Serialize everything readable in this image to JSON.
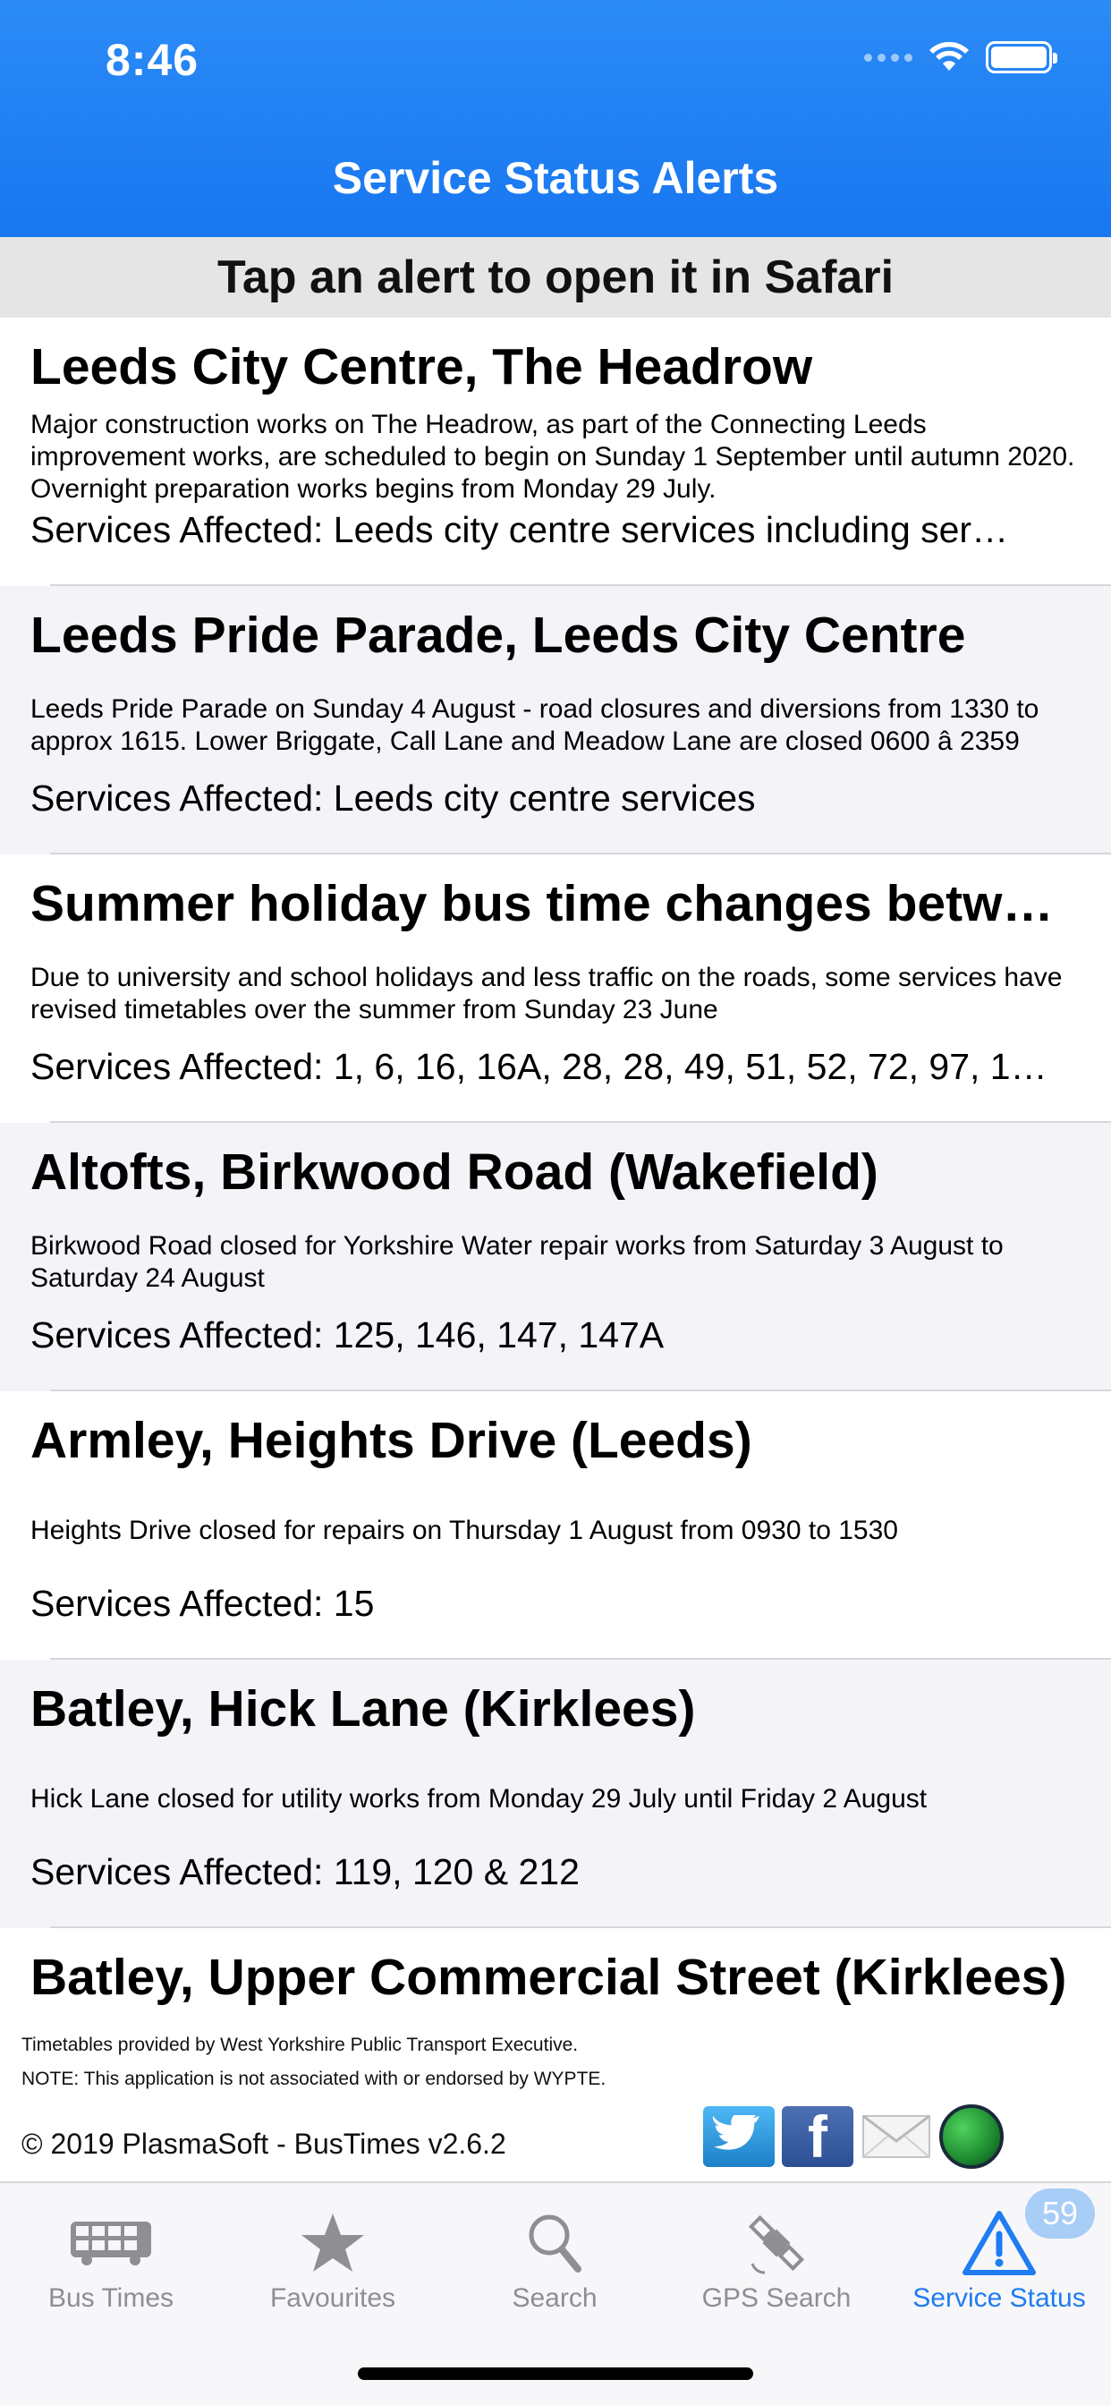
{
  "status_bar": {
    "time": "8:46"
  },
  "nav": {
    "title": "Service Status Alerts"
  },
  "banner": {
    "text": "Tap an alert to open it in Safari"
  },
  "alerts": [
    {
      "title": "Leeds City Centre, The Headrow",
      "description": "Major construction works on The Headrow, as part of the Connecting Leeds improvement works, are scheduled to begin on Sunday 1 September until autumn 2020. Overnight preparation works begins from Monday 29 July.",
      "services": "Services Affected: Leeds city centre services including ser…"
    },
    {
      "title": "Leeds Pride Parade, Leeds City Centre",
      "description": "Leeds Pride Parade on Sunday 4 August - road closures and diversions from 1330 to approx 1615.  Lower Briggate, Call Lane and Meadow Lane are closed 0600 â 2359",
      "services": "Services Affected: Leeds city centre services"
    },
    {
      "title": "Summer holiday bus time changes betwee…",
      "description": "Due to university and school holidays and less traffic on the roads, some services have revised timetables over the summer from Sunday 23 June",
      "services": "Services Affected: 1, 6, 16, 16A, 28, 28, 49, 51, 52, 72, 97, 1…"
    },
    {
      "title": "Altofts, Birkwood Road (Wakefield)",
      "description": "Birkwood Road closed for Yorkshire Water repair works from Saturday 3 August to Saturday 24 August",
      "services": "Services Affected: 125, 146, 147, 147A"
    },
    {
      "title": "Armley, Heights Drive (Leeds)",
      "description": "Heights Drive closed for repairs on Thursday 1 August from 0930 to 1530",
      "services": "Services Affected: 15"
    },
    {
      "title": "Batley, Hick Lane (Kirklees)",
      "description": "Hick Lane closed for utility works from Monday 29 July until Friday 2 August",
      "services": "Services Affected: 119, 120 & 212"
    },
    {
      "title": "Batley, Upper Commercial Street (Kirklees)",
      "description": "",
      "services": ""
    }
  ],
  "footer": {
    "line1": "Timetables provided by West Yorkshire Public Transport Executive.",
    "line2": "NOTE: This application is not associated with or endorsed by WYPTE.",
    "copyright": "© 2019 PlasmaSoft - BusTimes v2.6.2",
    "facebook_glyph": "f"
  },
  "tabs": [
    {
      "label": "Bus Times",
      "icon": "bus-icon"
    },
    {
      "label": "Favourites",
      "icon": "star-icon"
    },
    {
      "label": "Search",
      "icon": "magnifier-icon"
    },
    {
      "label": "GPS Search",
      "icon": "satellite-icon"
    },
    {
      "label": "Service Status",
      "icon": "warning-triangle-icon",
      "badge": "59"
    }
  ],
  "colors": {
    "nav_bar": "#1877f0",
    "active_tab": "#1f7cf2",
    "inactive_tab": "#8e8e93",
    "badge": "#a8cdf7"
  }
}
